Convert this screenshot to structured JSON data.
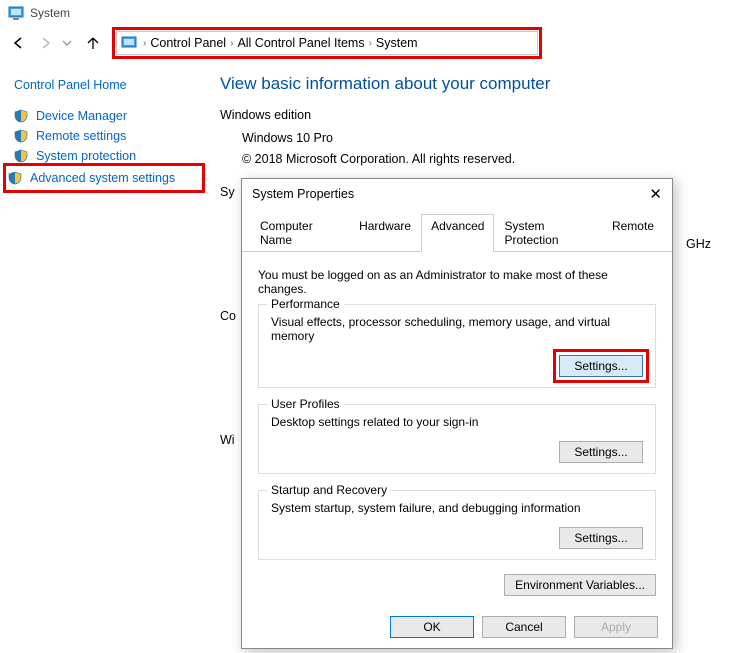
{
  "window": {
    "title": "System"
  },
  "nav": {
    "breadcrumbs": [
      "Control Panel",
      "All Control Panel Items",
      "System"
    ]
  },
  "sidebar": {
    "home": "Control Panel Home",
    "items": [
      {
        "label": "Device Manager"
      },
      {
        "label": "Remote settings"
      },
      {
        "label": "System protection"
      },
      {
        "label": "Advanced system settings"
      }
    ]
  },
  "main": {
    "heading": "View basic information about your computer",
    "edition_header": "Windows edition",
    "edition_name": "Windows 10 Pro",
    "copyright": "© 2018 Microsoft Corporation. All rights reserved.",
    "sys_header": "Sy",
    "ghz_fragment": "GHz",
    "col_label": "Co",
    "wi_label": "Wi"
  },
  "dialog": {
    "title": "System Properties",
    "tabs": [
      "Computer Name",
      "Hardware",
      "Advanced",
      "System Protection",
      "Remote"
    ],
    "active_tab": 2,
    "admin_note": "You must be logged on as an Administrator to make most of these changes.",
    "performance": {
      "legend": "Performance",
      "desc": "Visual effects, processor scheduling, memory usage, and virtual memory",
      "button": "Settings..."
    },
    "profiles": {
      "legend": "User Profiles",
      "desc": "Desktop settings related to your sign-in",
      "button": "Settings..."
    },
    "startup": {
      "legend": "Startup and Recovery",
      "desc": "System startup, system failure, and debugging information",
      "button": "Settings..."
    },
    "env_button": "Environment Variables...",
    "footer": {
      "ok": "OK",
      "cancel": "Cancel",
      "apply": "Apply"
    }
  }
}
